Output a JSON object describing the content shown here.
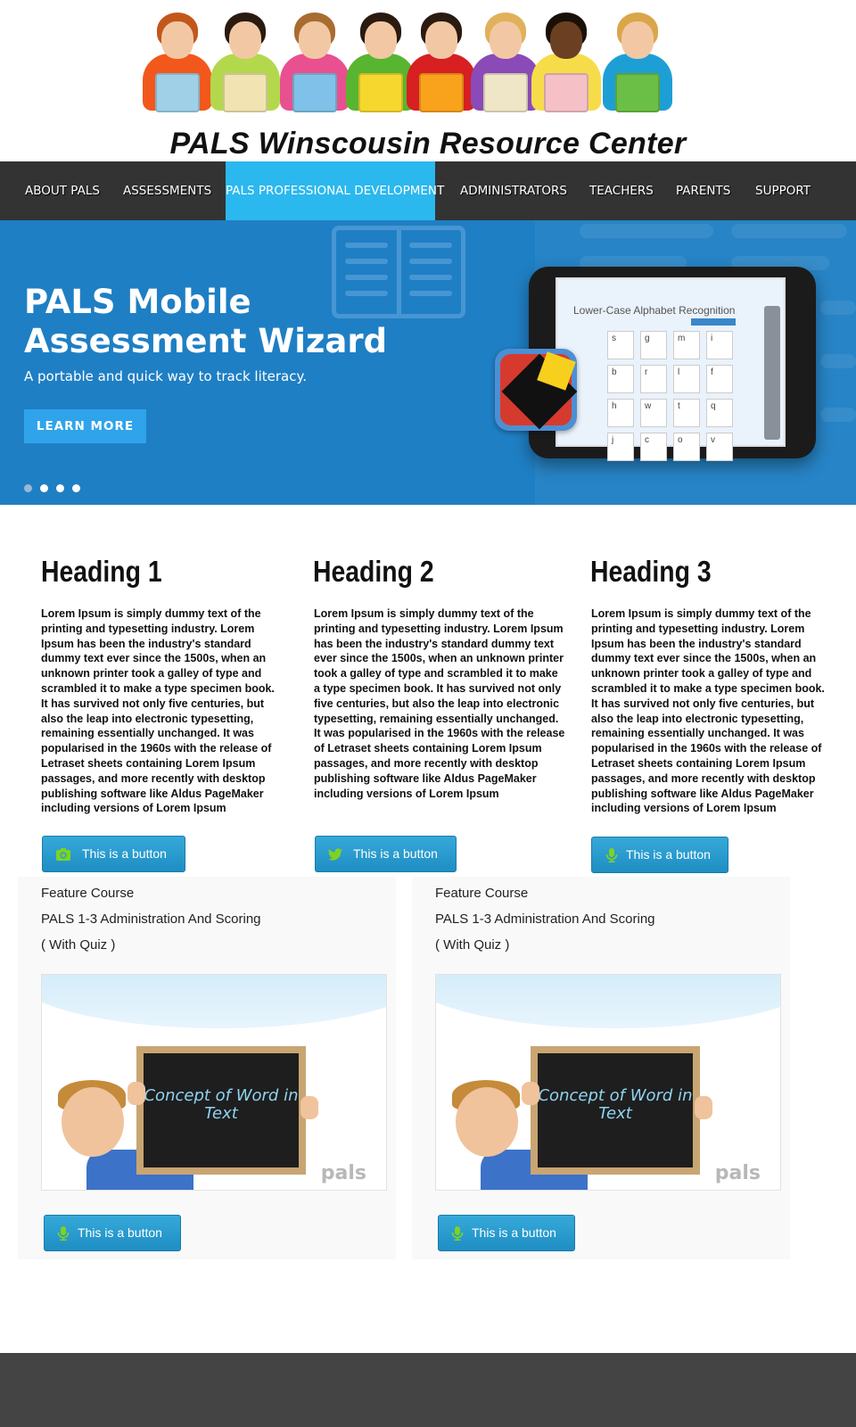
{
  "header": {
    "site_title": "PALS Winscousin Resource Center"
  },
  "nav": {
    "items": [
      {
        "label": "ABOUT PALS"
      },
      {
        "label": "ASSESSMENTS"
      },
      {
        "label": "PALS PROFESSIONAL DEVELOPMENT",
        "active": true
      },
      {
        "label": "ADMINISTRATORS"
      },
      {
        "label": "TEACHERS"
      },
      {
        "label": "PARENTS"
      },
      {
        "label": "SUPPORT"
      }
    ]
  },
  "hero": {
    "title": "PALS Mobile Assessment Wizard",
    "subtitle": "A portable and quick way to track literacy.",
    "button": "LEARN MORE",
    "slides": 4,
    "active_slide": 1,
    "tablet_screen_title": "Lower-Case Alphabet Recognition",
    "letters": [
      "s",
      "g",
      "m",
      "i",
      "b",
      "r",
      "l",
      "f",
      "h",
      "w",
      "t",
      "q",
      "j",
      "c",
      "o",
      "v"
    ]
  },
  "columns": [
    {
      "heading": "Heading 1",
      "body": "Lorem Ipsum is simply dummy text of the printing and typesetting industry. Lorem Ipsum has been the industry's standard dummy text ever since the 1500s, when an unknown printer took a galley of type and scrambled it to make a type specimen book. It has survived not only five centuries, but also the leap into electronic typesetting, remaining essentially unchanged. It was popularised in the 1960s with the release of Letraset sheets containing Lorem Ipsum passages, and more recently with desktop publishing software like Aldus PageMaker including versions of Lorem Ipsum",
      "button": "This is a button",
      "button_icon": "camera-icon"
    },
    {
      "heading": "Heading 2",
      "body": "Lorem Ipsum is simply dummy text of the printing and typesetting industry. Lorem Ipsum has been the industry's standard dummy text ever since the 1500s, when an unknown printer took a galley of type and scrambled it to make a type specimen book. It has survived not only five centuries, but also the leap into electronic typesetting, remaining essentially unchanged. It was popularised in the 1960s with the release of Letraset sheets containing Lorem Ipsum passages, and more recently with desktop publishing software like Aldus PageMaker including versions of Lorem Ipsum",
      "button": "This is a button",
      "button_icon": "twitter-icon"
    },
    {
      "heading": "Heading 3",
      "body": "Lorem Ipsum is simply dummy text of the printing and typesetting industry. Lorem Ipsum has been the industry's standard dummy text ever since the 1500s, when an unknown printer took a galley of type and scrambled it to make a type specimen book. It has survived not only five centuries, but also the leap into electronic typesetting, remaining essentially unchanged. It was popularised in the 1960s with the release of Letraset sheets containing Lorem Ipsum passages, and more recently with desktop publishing software like Aldus PageMaker including versions of Lorem Ipsum",
      "button": "This is a button",
      "button_icon": "microphone-icon"
    }
  ],
  "features": [
    {
      "label": "Feature Course",
      "course": "PALS 1-3 Administration And Scoring",
      "note": "( With Quiz )",
      "thumb_text": "Concept of Word in Text",
      "thumb_logo": "pals",
      "button": "This is a button",
      "button_icon": "microphone-icon"
    },
    {
      "label": "Feature Course",
      "course": "PALS 1-3 Administration And Scoring",
      "note": "( With Quiz )",
      "thumb_text": "Concept of Word in Text",
      "thumb_logo": "pals",
      "button": "This is a button",
      "button_icon": "microphone-icon"
    }
  ],
  "colors": {
    "nav_bg": "#333333",
    "nav_active": "#2bb8ee",
    "hero_bg": "#1f7fc4",
    "button_blue": "#2a9cd0",
    "icon_green": "#7ed321",
    "footer_bg": "#444444"
  }
}
